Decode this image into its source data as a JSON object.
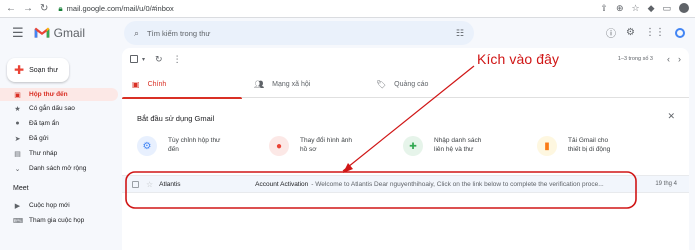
{
  "browser": {
    "url": "mail.google.com/mail/u/0/#inbox"
  },
  "app": {
    "name": "Gmail"
  },
  "search": {
    "placeholder": "Tìm kiếm trong thư"
  },
  "compose_label": "Soạn thư",
  "sidebar": {
    "items": [
      {
        "label": "Hộp thư đến",
        "icon": "inbox-icon",
        "active": true
      },
      {
        "label": "Có gắn dấu sao",
        "icon": "star-icon"
      },
      {
        "label": "Đã tạm ẩn",
        "icon": "clock-icon"
      },
      {
        "label": "Đã gửi",
        "icon": "send-icon"
      },
      {
        "label": "Thư nháp",
        "icon": "draft-icon"
      },
      {
        "label": "Danh sách mở rộng",
        "icon": "chevron-down-icon"
      }
    ],
    "meet_heading": "Meet",
    "meet_items": [
      {
        "label": "Cuộc họp mới",
        "icon": "video-icon"
      },
      {
        "label": "Tham gia cuộc họp",
        "icon": "keyboard-icon"
      }
    ]
  },
  "toolbar": {
    "pagination": "1–3 trong số 3"
  },
  "tabs": [
    {
      "label": "Chính",
      "icon": "inbox-icon",
      "selected": true
    },
    {
      "label": "Mạng xã hội",
      "icon": "people-icon"
    },
    {
      "label": "Quảng cáo",
      "icon": "tag-icon"
    }
  ],
  "getting_started": {
    "title": "Bắt đầu sử dụng Gmail",
    "cards": [
      {
        "line1": "Tùy chỉnh hộp thư",
        "line2": "đến",
        "icon": "gear-icon",
        "color": "#e8f0fe",
        "accent": "#4285f4"
      },
      {
        "line1": "Thay đổi hình ảnh",
        "line2": "hồ sơ",
        "icon": "account-icon",
        "color": "#fce8e6",
        "accent": "#ea4335"
      },
      {
        "line1": "Nhập danh sách",
        "line2": "liên hệ và thư",
        "icon": "add-person-icon",
        "color": "#e6f4ea",
        "accent": "#34a853"
      },
      {
        "line1": "Tải Gmail cho",
        "line2": "thiết bị di động",
        "icon": "phone-icon",
        "color": "#fef7e0",
        "accent": "#fa7b17"
      }
    ]
  },
  "email": {
    "sender": "Atlantis",
    "subject": "Account Activation",
    "snippet": "- Welcome to Atlantis Dear nguyenthihoaiy, Click on the link below to complete the verification proce...",
    "date": "19 thg 4"
  },
  "annotation": {
    "text": "Kích vào đây",
    "color": "#d01616"
  }
}
